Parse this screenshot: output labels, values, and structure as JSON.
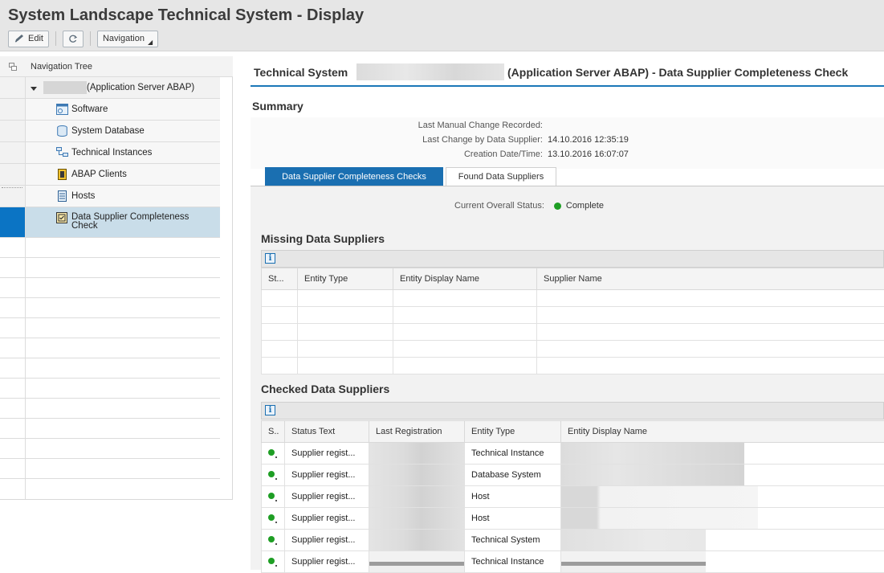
{
  "page": {
    "title": "System Landscape Technical System - Display"
  },
  "toolbar": {
    "edit_label": "Edit",
    "navigation_label": "Navigation"
  },
  "nav_tree": {
    "header": "Navigation Tree",
    "root_label": "(Application Server ABAP)",
    "items": [
      {
        "label": "Software",
        "icon": "software-icon"
      },
      {
        "label": "System Database",
        "icon": "database-icon"
      },
      {
        "label": "Technical Instances",
        "icon": "technical-instances-icon"
      },
      {
        "label": "ABAP Clients",
        "icon": "abap-clients-icon"
      },
      {
        "label": "Hosts",
        "icon": "hosts-icon"
      },
      {
        "label": "Data Supplier Completeness Check",
        "icon": "completeness-check-icon",
        "selected": true
      }
    ]
  },
  "content": {
    "title_prefix": "Technical System",
    "title_suffix": "(Application Server ABAP) - Data Supplier Completeness Check",
    "summary": {
      "header": "Summary",
      "last_manual_change_label": "Last Manual Change Recorded:",
      "last_manual_change_value": "",
      "last_change_supplier_label": "Last Change by Data Supplier:",
      "last_change_supplier_value": "14.10.2016 12:35:19",
      "creation_label": "Creation Date/Time:",
      "creation_value": "13.10.2016 16:07:07"
    },
    "tabs": [
      {
        "label": "Data Supplier Completeness Checks",
        "active": true
      },
      {
        "label": "Found Data Suppliers",
        "active": false
      }
    ],
    "overall_status_label": "Current Overall Status:",
    "overall_status_value": "Complete",
    "missing": {
      "header": "Missing Data Suppliers",
      "columns": [
        "St...",
        "Entity Type",
        "Entity Display Name",
        "Supplier Name"
      ],
      "empty_rows": 5
    },
    "checked": {
      "header": "Checked Data Suppliers",
      "columns": [
        "S..",
        "Status Text",
        "Last Registration",
        "Entity Type",
        "Entity Display Name"
      ],
      "rows": [
        {
          "status_text": "Supplier regist...",
          "entity_type": "Technical Instance"
        },
        {
          "status_text": "Supplier regist...",
          "entity_type": "Database System"
        },
        {
          "status_text": "Supplier regist...",
          "entity_type": "Host"
        },
        {
          "status_text": "Supplier regist...",
          "entity_type": "Host"
        },
        {
          "status_text": "Supplier regist...",
          "entity_type": "Technical System"
        },
        {
          "status_text": "Supplier regist...",
          "entity_type": "Technical Instance"
        }
      ]
    }
  },
  "colors": {
    "accent": "#1a6fb1",
    "selection": "#c9dde9",
    "status_green": "#1e9e24"
  }
}
